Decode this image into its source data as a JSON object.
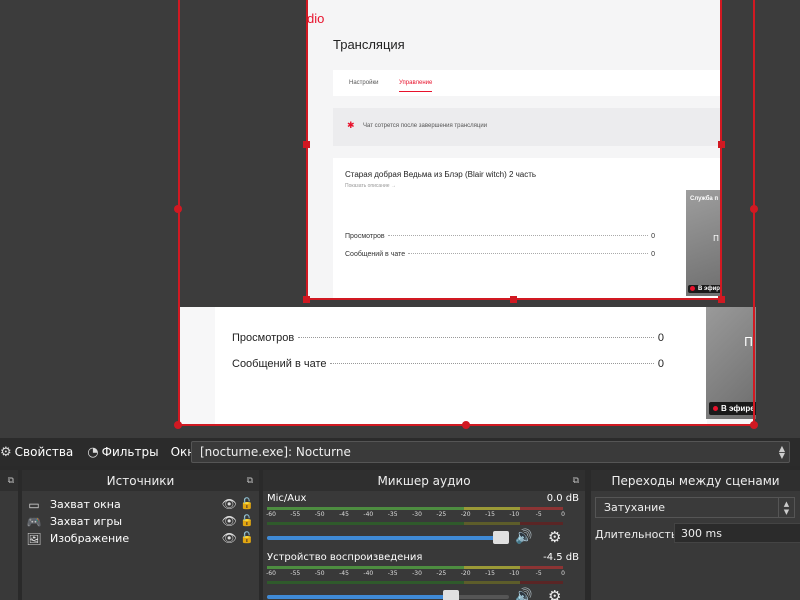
{
  "preview": {
    "logo_fragment": "dio",
    "page_title": "Трансляция",
    "tabs": [
      {
        "label": "Настройки",
        "active": false
      },
      {
        "label": "Управление",
        "active": true
      }
    ],
    "notice_text": "Чат сотрется после завершения трансляции",
    "video_title": "Старая добрая Ведьма из Блэр (Blair witch) 2 часть",
    "video_link": "Показать описание →",
    "stats": [
      {
        "label": "Просмотров",
        "value": "0"
      },
      {
        "label": "Сообщений в чате",
        "value": "0"
      }
    ],
    "thumb_service": "Служба п",
    "thumb_letter": "П",
    "live_badge": "В эфир",
    "live_badge_outer": "В эфире"
  },
  "context_bar": {
    "properties_label": "Свойства",
    "filters_label": "Фильтры",
    "window_label": "Окно",
    "window_value": "[nocturne.exe]: Nocturne"
  },
  "sources": {
    "title": "Источники",
    "items": [
      {
        "label": "Захват окна",
        "icon": "window-icon"
      },
      {
        "label": "Захват игры",
        "icon": "gamepad-icon"
      },
      {
        "label": "Изображение",
        "icon": "image-icon"
      }
    ]
  },
  "mixer": {
    "title": "Микшер аудио",
    "ticks": [
      "-60",
      "-55",
      "-50",
      "-45",
      "-40",
      "-35",
      "-30",
      "-25",
      "-20",
      "-15",
      "-10",
      "-5",
      "0"
    ],
    "channels": [
      {
        "name": "Mic/Aux",
        "db": "0.0 dB",
        "volume": 1.0
      },
      {
        "name": "Устройство воспроизведения",
        "db": "-4.5 dB",
        "volume": 0.78
      }
    ]
  },
  "transitions": {
    "title": "Переходы между сценами",
    "selected": "Затухание",
    "duration_label": "Длительность",
    "duration_value": "300 ms"
  },
  "colors": {
    "selection": "#d11922",
    "accent": "#e8122c",
    "fader": "#3f8ad6"
  }
}
